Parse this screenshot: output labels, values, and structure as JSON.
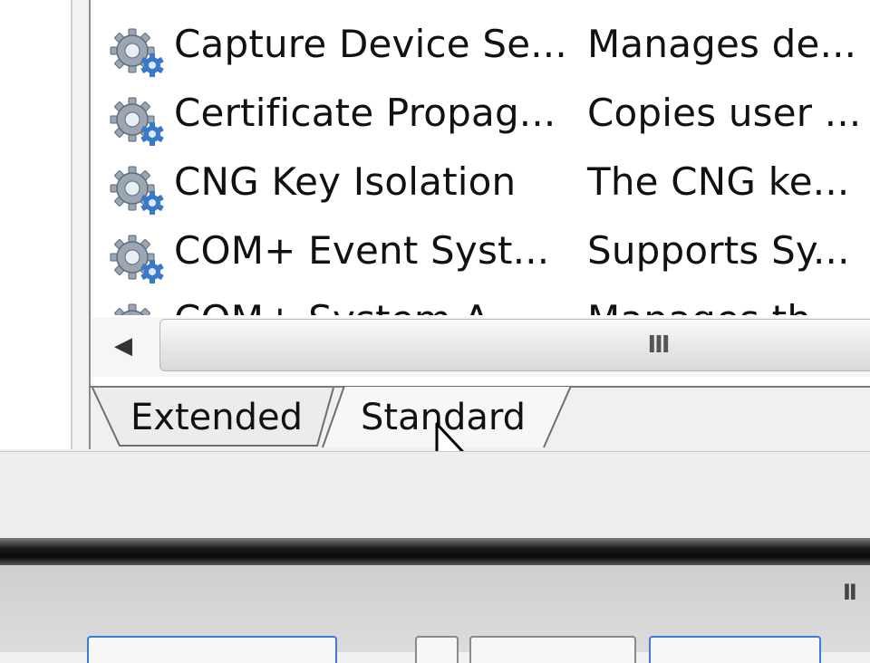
{
  "services": {
    "rows": [
      {
        "name": "Capture Device Se...",
        "description": "Manages de..."
      },
      {
        "name": "Certificate Propag...",
        "description": "Copies user ..."
      },
      {
        "name": "CNG Key Isolation",
        "description": "The CNG ke..."
      },
      {
        "name": "COM+ Event Syst...",
        "description": "Supports Sy..."
      },
      {
        "name": "COM+ System A...",
        "description": "Manages th..."
      }
    ]
  },
  "scrollbar": {
    "left_arrow": "◀",
    "grip": "III"
  },
  "tabs": [
    {
      "label": "Extended",
      "selected": false
    },
    {
      "label": "Standard",
      "selected": true
    }
  ],
  "lower_window": {
    "grip": "II"
  },
  "icons": {
    "service": "gear-icon",
    "cursor": "mouse-cursor-icon"
  },
  "colors": {
    "gear_fill": "#9aa6b4",
    "gear_accent": "#3a78c8",
    "focus_blue": "#3a7bd5"
  }
}
